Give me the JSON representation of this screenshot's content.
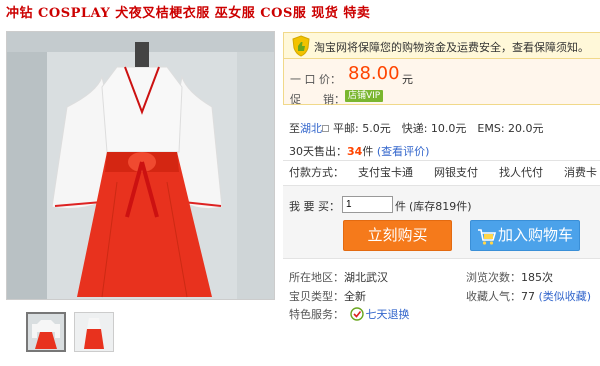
{
  "title": "冲钻 COSPLAY 犬夜叉桔梗衣服 巫女服 COS服 现货 特卖",
  "notice": {
    "text": "淘宝网将保障您的购物资金及运费安全，查看保障须知。"
  },
  "price": {
    "label": "一 口 价：",
    "value": "88.00",
    "unit": "元"
  },
  "promo": {
    "label": "促　　销：",
    "badge": "店铺VIP"
  },
  "shipping": {
    "prefix": "至",
    "region": "湖北",
    "options": "平邮: 5.0元　快递: 10.0元　EMS: 20.0元"
  },
  "sales": {
    "label": "30天售出：",
    "count": "34",
    "count_unit": "件",
    "review_link": "(查看评价)"
  },
  "payment": {
    "label": "付款方式：",
    "options": [
      "支付宝卡通",
      "网银支付",
      "找人代付",
      "消费卡"
    ]
  },
  "quantity": {
    "label": "我 要 买：",
    "value": "1",
    "unit": "件",
    "stock": "(库存819件)"
  },
  "buttons": {
    "buy": "立刻购买",
    "cart": "加入购物车"
  },
  "info": {
    "location_label": "所在地区：",
    "location": "湖北武汉",
    "views_label": "浏览次数：",
    "views": "185次",
    "type_label": "宝贝类型：",
    "type": "全新",
    "fav_label": "收藏人气：",
    "fav": "77",
    "fav_link": "(类似收藏)",
    "service_label": "特色服务：",
    "service": "七天退换"
  },
  "colors": {
    "price": "#ff4400",
    "buy": "#f57a1b",
    "cart": "#4ba2ea",
    "title": "#cc0000"
  }
}
